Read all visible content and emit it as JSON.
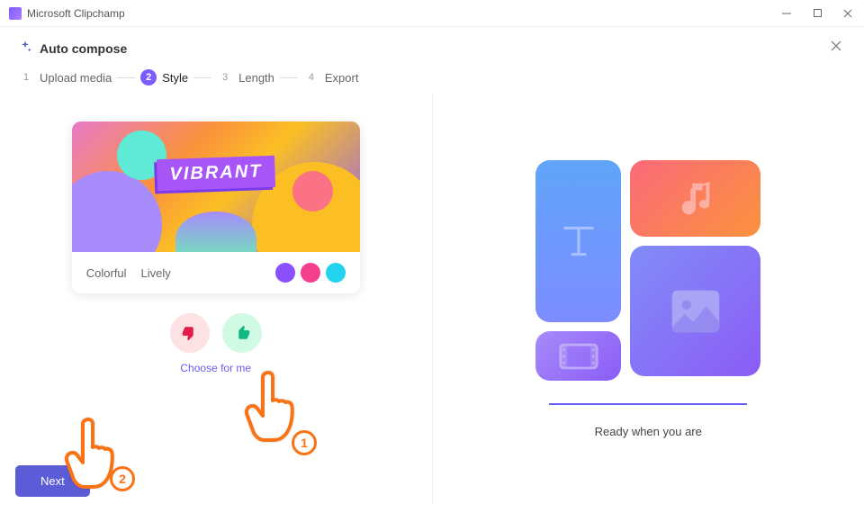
{
  "titlebar": {
    "title": "Microsoft Clipchamp"
  },
  "header": {
    "title": "Auto compose"
  },
  "stepper": {
    "steps": [
      {
        "num": "1",
        "label": "Upload media"
      },
      {
        "num": "2",
        "label": "Style"
      },
      {
        "num": "3",
        "label": "Length"
      },
      {
        "num": "4",
        "label": "Export"
      }
    ]
  },
  "style_card": {
    "name": "VIBRANT",
    "tag1": "Colorful",
    "tag2": "Lively",
    "swatches": [
      "#8a4fff",
      "#f43f8e",
      "#22d3ee"
    ]
  },
  "actions": {
    "choose_for_me": "Choose for me",
    "next": "Next"
  },
  "right_panel": {
    "ready_text": "Ready when you are"
  },
  "annotations": {
    "badge1": "1",
    "badge2": "2"
  }
}
